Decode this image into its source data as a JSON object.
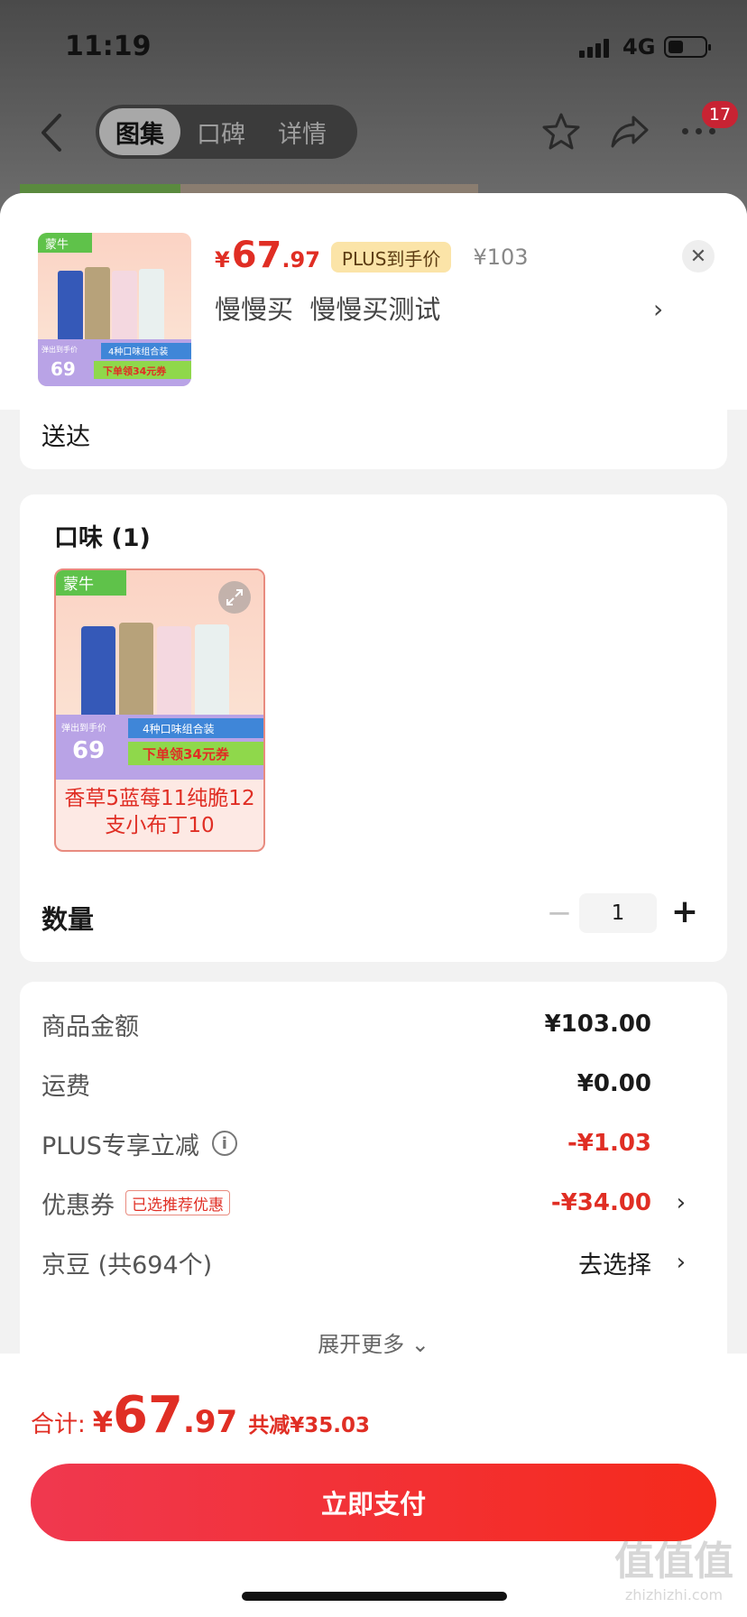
{
  "status_bar": {
    "time": "11:19",
    "network": "4G"
  },
  "nav": {
    "tabs": [
      {
        "label": "图集",
        "active": true
      },
      {
        "label": "口碑",
        "active": false
      },
      {
        "label": "详情",
        "active": false
      }
    ],
    "badge_count": "17"
  },
  "product": {
    "currency": "¥",
    "price_int": "67",
    "price_dec": ".97",
    "plus_label": "PLUS到手价",
    "original_price": "¥103",
    "name": "慢慢买  慢慢买测试",
    "thumb": {
      "brand": "蒙牛",
      "promo_label": "弹出到手价",
      "promo_price": "69",
      "combo": "4种口味组合装",
      "coupon": "下单领34元券"
    }
  },
  "delivery": {
    "text": "送达"
  },
  "flavor": {
    "title": "口味 (1)",
    "option_label": "香草5蓝莓11纯脆12支小布丁10"
  },
  "quantity": {
    "label": "数量",
    "value": "1",
    "minus": "−",
    "plus": "+"
  },
  "summary": {
    "rows": [
      {
        "label": "商品金额",
        "value": "¥103.00"
      },
      {
        "label": "运费",
        "value": "¥0.00"
      },
      {
        "label": "PLUS专享立减",
        "value": "-¥1.03"
      },
      {
        "label": "优惠券",
        "tag": "已选推荐优惠",
        "value": "-¥34.00"
      },
      {
        "label": "京豆 (共694个)",
        "value": "去选择"
      }
    ],
    "expand_more": "展开更多"
  },
  "footer": {
    "total_label": "合计:",
    "currency": "¥",
    "total_int": "67",
    "total_dec": ".97",
    "total_saved": "共减¥35.03",
    "pay_button": "立即支付"
  },
  "watermark": {
    "big": "值值值",
    "small": "zhizhizhi.com"
  },
  "colors": {
    "accent_red": "#e02e24",
    "plus_gold": "#fbe4a8",
    "pay_gradient_start": "#f0384f",
    "pay_gradient_end": "#f52a1c"
  }
}
